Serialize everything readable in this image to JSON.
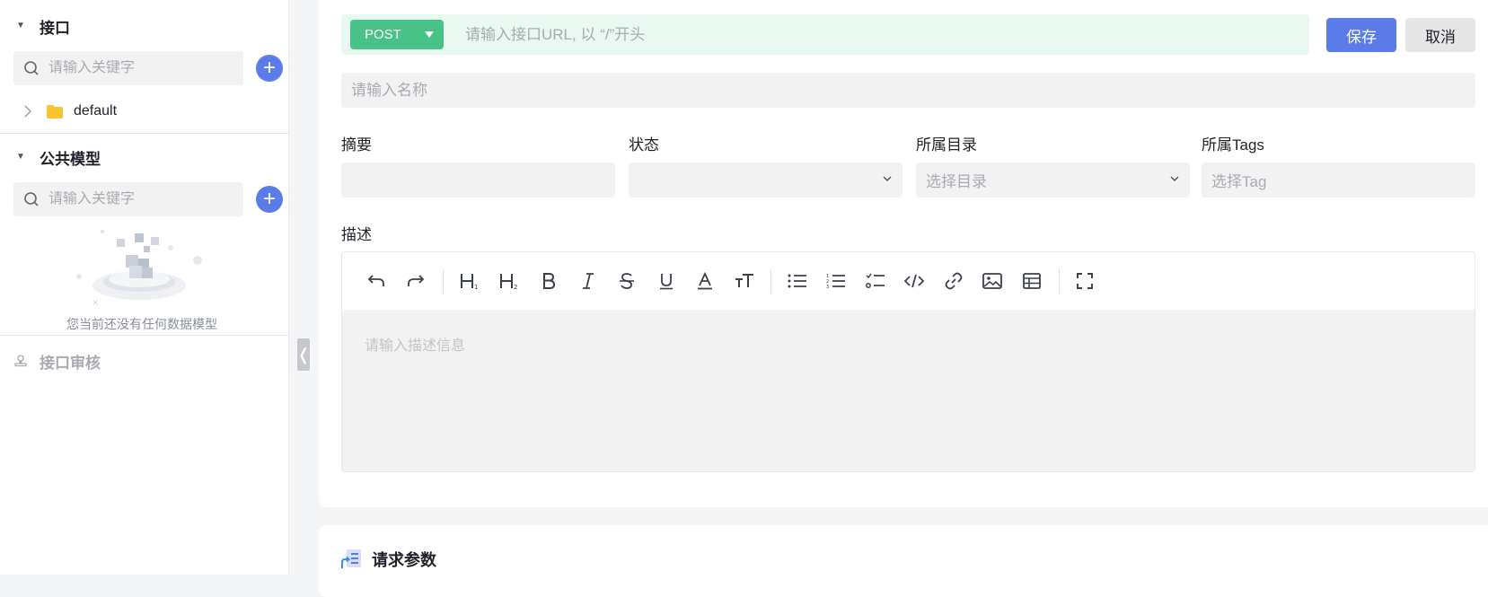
{
  "sidebar": {
    "api_section": {
      "title": "接口",
      "search_placeholder": "请输入关键字",
      "tree_items": [
        {
          "label": "default"
        }
      ]
    },
    "model_section": {
      "title": "公共模型",
      "search_placeholder": "请输入关键字",
      "empty_text": "您当前还没有任何数据模型"
    },
    "audit": {
      "label": "接口审核"
    }
  },
  "request": {
    "method": "POST",
    "url_placeholder": "请输入接口URL, 以 “/”开头",
    "save_label": "保存",
    "cancel_label": "取消",
    "name_placeholder": "请输入名称"
  },
  "fields": {
    "summary_label": "摘要",
    "status_label": "状态",
    "directory_label": "所属目录",
    "directory_placeholder": "选择目录",
    "tags_label": "所属Tags",
    "tags_placeholder": "选择Tag"
  },
  "description": {
    "label": "描述",
    "placeholder": "请输入描述信息"
  },
  "params": {
    "title": "请求参数"
  },
  "colors": {
    "accent": "#5b7ce8",
    "method_green": "#49c287",
    "url_bg": "#e9f8f0"
  }
}
